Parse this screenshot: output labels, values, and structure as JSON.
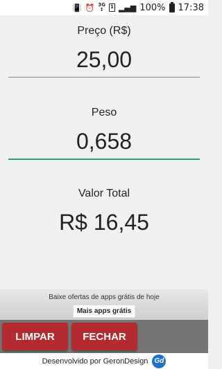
{
  "status_bar": {
    "network": "3G",
    "sim": "1",
    "battery": "100%",
    "time": "17:38",
    "icons": [
      "vibrate-icon",
      "alarm-icon",
      "network-3g-icon",
      "sim-icon",
      "signal-icon",
      "battery-icon"
    ]
  },
  "price": {
    "label": "Preço (R$)",
    "value": "25,00"
  },
  "weight": {
    "label": "Peso",
    "value": "0,658"
  },
  "total": {
    "label": "Valor Total",
    "value": "R$ 16,45"
  },
  "ad": {
    "text": "Baixe ofertas de apps grátis de hoje",
    "button": "Mais apps grátis"
  },
  "actions": {
    "clear": "LIMPAR",
    "close": "FECHAR"
  },
  "footer": {
    "credit": "Desenvolvido por GeronDesign",
    "logo_text": "Gd"
  },
  "colors": {
    "accent": "#1d9e85",
    "button": "#b52a2f",
    "button_bar": "#757575"
  }
}
